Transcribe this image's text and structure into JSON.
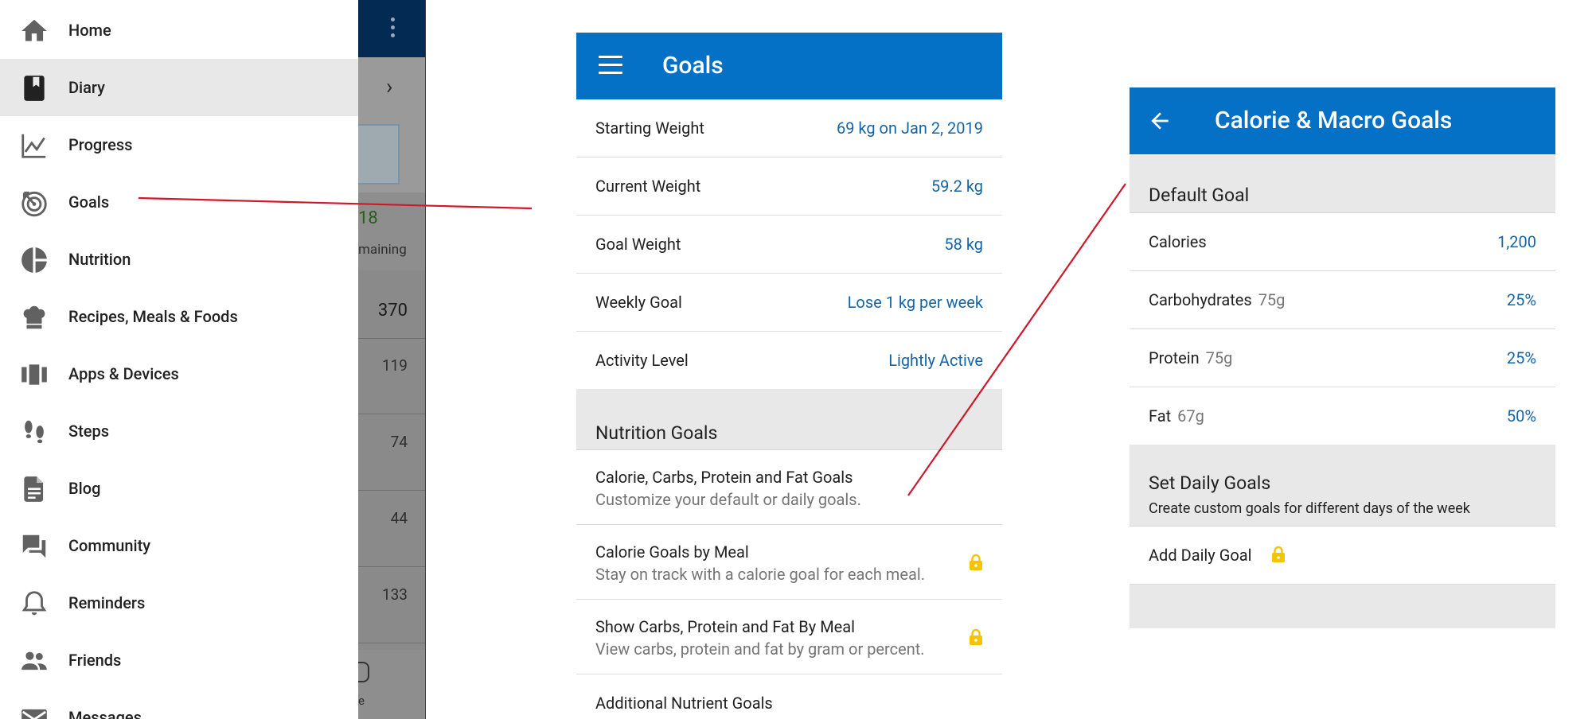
{
  "colors": {
    "brand_blue": "#0571c6",
    "value_blue": "#1565a6",
    "lock_yellow": "#f5c400",
    "annotation_red": "#d0182b",
    "section_gray": "#e8e8e8"
  },
  "drawer": {
    "items": [
      {
        "label": "Home",
        "icon": "home-icon"
      },
      {
        "label": "Diary",
        "icon": "diary-book-icon",
        "selected": true
      },
      {
        "label": "Progress",
        "icon": "chart-line-icon"
      },
      {
        "label": "Goals",
        "icon": "target-icon"
      },
      {
        "label": "Nutrition",
        "icon": "pie-chart-icon"
      },
      {
        "label": "Recipes, Meals & Foods",
        "icon": "chef-hat-icon"
      },
      {
        "label": "Apps & Devices",
        "icon": "devices-icon"
      },
      {
        "label": "Steps",
        "icon": "footprints-icon"
      },
      {
        "label": "Blog",
        "icon": "document-icon"
      },
      {
        "label": "Community",
        "icon": "forum-icon"
      },
      {
        "label": "Reminders",
        "icon": "bell-icon"
      },
      {
        "label": "Friends",
        "icon": "people-icon"
      },
      {
        "label": "Messages",
        "icon": "mail-icon"
      }
    ]
  },
  "background_app": {
    "remaining_value": "18",
    "remaining_label": "maining",
    "diary_values": [
      "370",
      "119",
      "74",
      "44",
      "133"
    ],
    "bottom_nav_label": "e"
  },
  "goals_screen": {
    "title": "Goals",
    "weight_rows": [
      {
        "label": "Starting Weight",
        "value": "69 kg on Jan 2, 2019"
      },
      {
        "label": "Current Weight",
        "value": "59.2 kg"
      },
      {
        "label": "Goal Weight",
        "value": "58 kg"
      },
      {
        "label": "Weekly Goal",
        "value": "Lose 1 kg per week"
      },
      {
        "label": "Activity Level",
        "value": "Lightly Active"
      }
    ],
    "nutrition_section_title": "Nutrition Goals",
    "nutrition_rows": [
      {
        "title": "Calorie, Carbs, Protein and Fat Goals",
        "subtitle": "Customize your default or daily goals.",
        "locked": false
      },
      {
        "title": "Calorie Goals by Meal",
        "subtitle": "Stay on track with a calorie goal for each meal.",
        "locked": true
      },
      {
        "title": "Show Carbs, Protein and Fat By Meal",
        "subtitle": "View carbs, protein and fat by gram or percent.",
        "locked": true
      },
      {
        "title": "Additional Nutrient Goals",
        "subtitle": "",
        "locked": false
      }
    ]
  },
  "macro_screen": {
    "title": "Calorie & Macro Goals",
    "default_section_title": "Default Goal",
    "rows": [
      {
        "label": "Calories",
        "grams": "",
        "value": "1,200"
      },
      {
        "label": "Carbohydrates",
        "grams": "75g",
        "value": "25%"
      },
      {
        "label": "Protein",
        "grams": "75g",
        "value": "25%"
      },
      {
        "label": "Fat",
        "grams": "67g",
        "value": "50%"
      }
    ],
    "daily_section_title": "Set Daily Goals",
    "daily_section_subtitle": "Create custom goals for different days of the week",
    "add_daily_goal_label": "Add Daily Goal"
  }
}
